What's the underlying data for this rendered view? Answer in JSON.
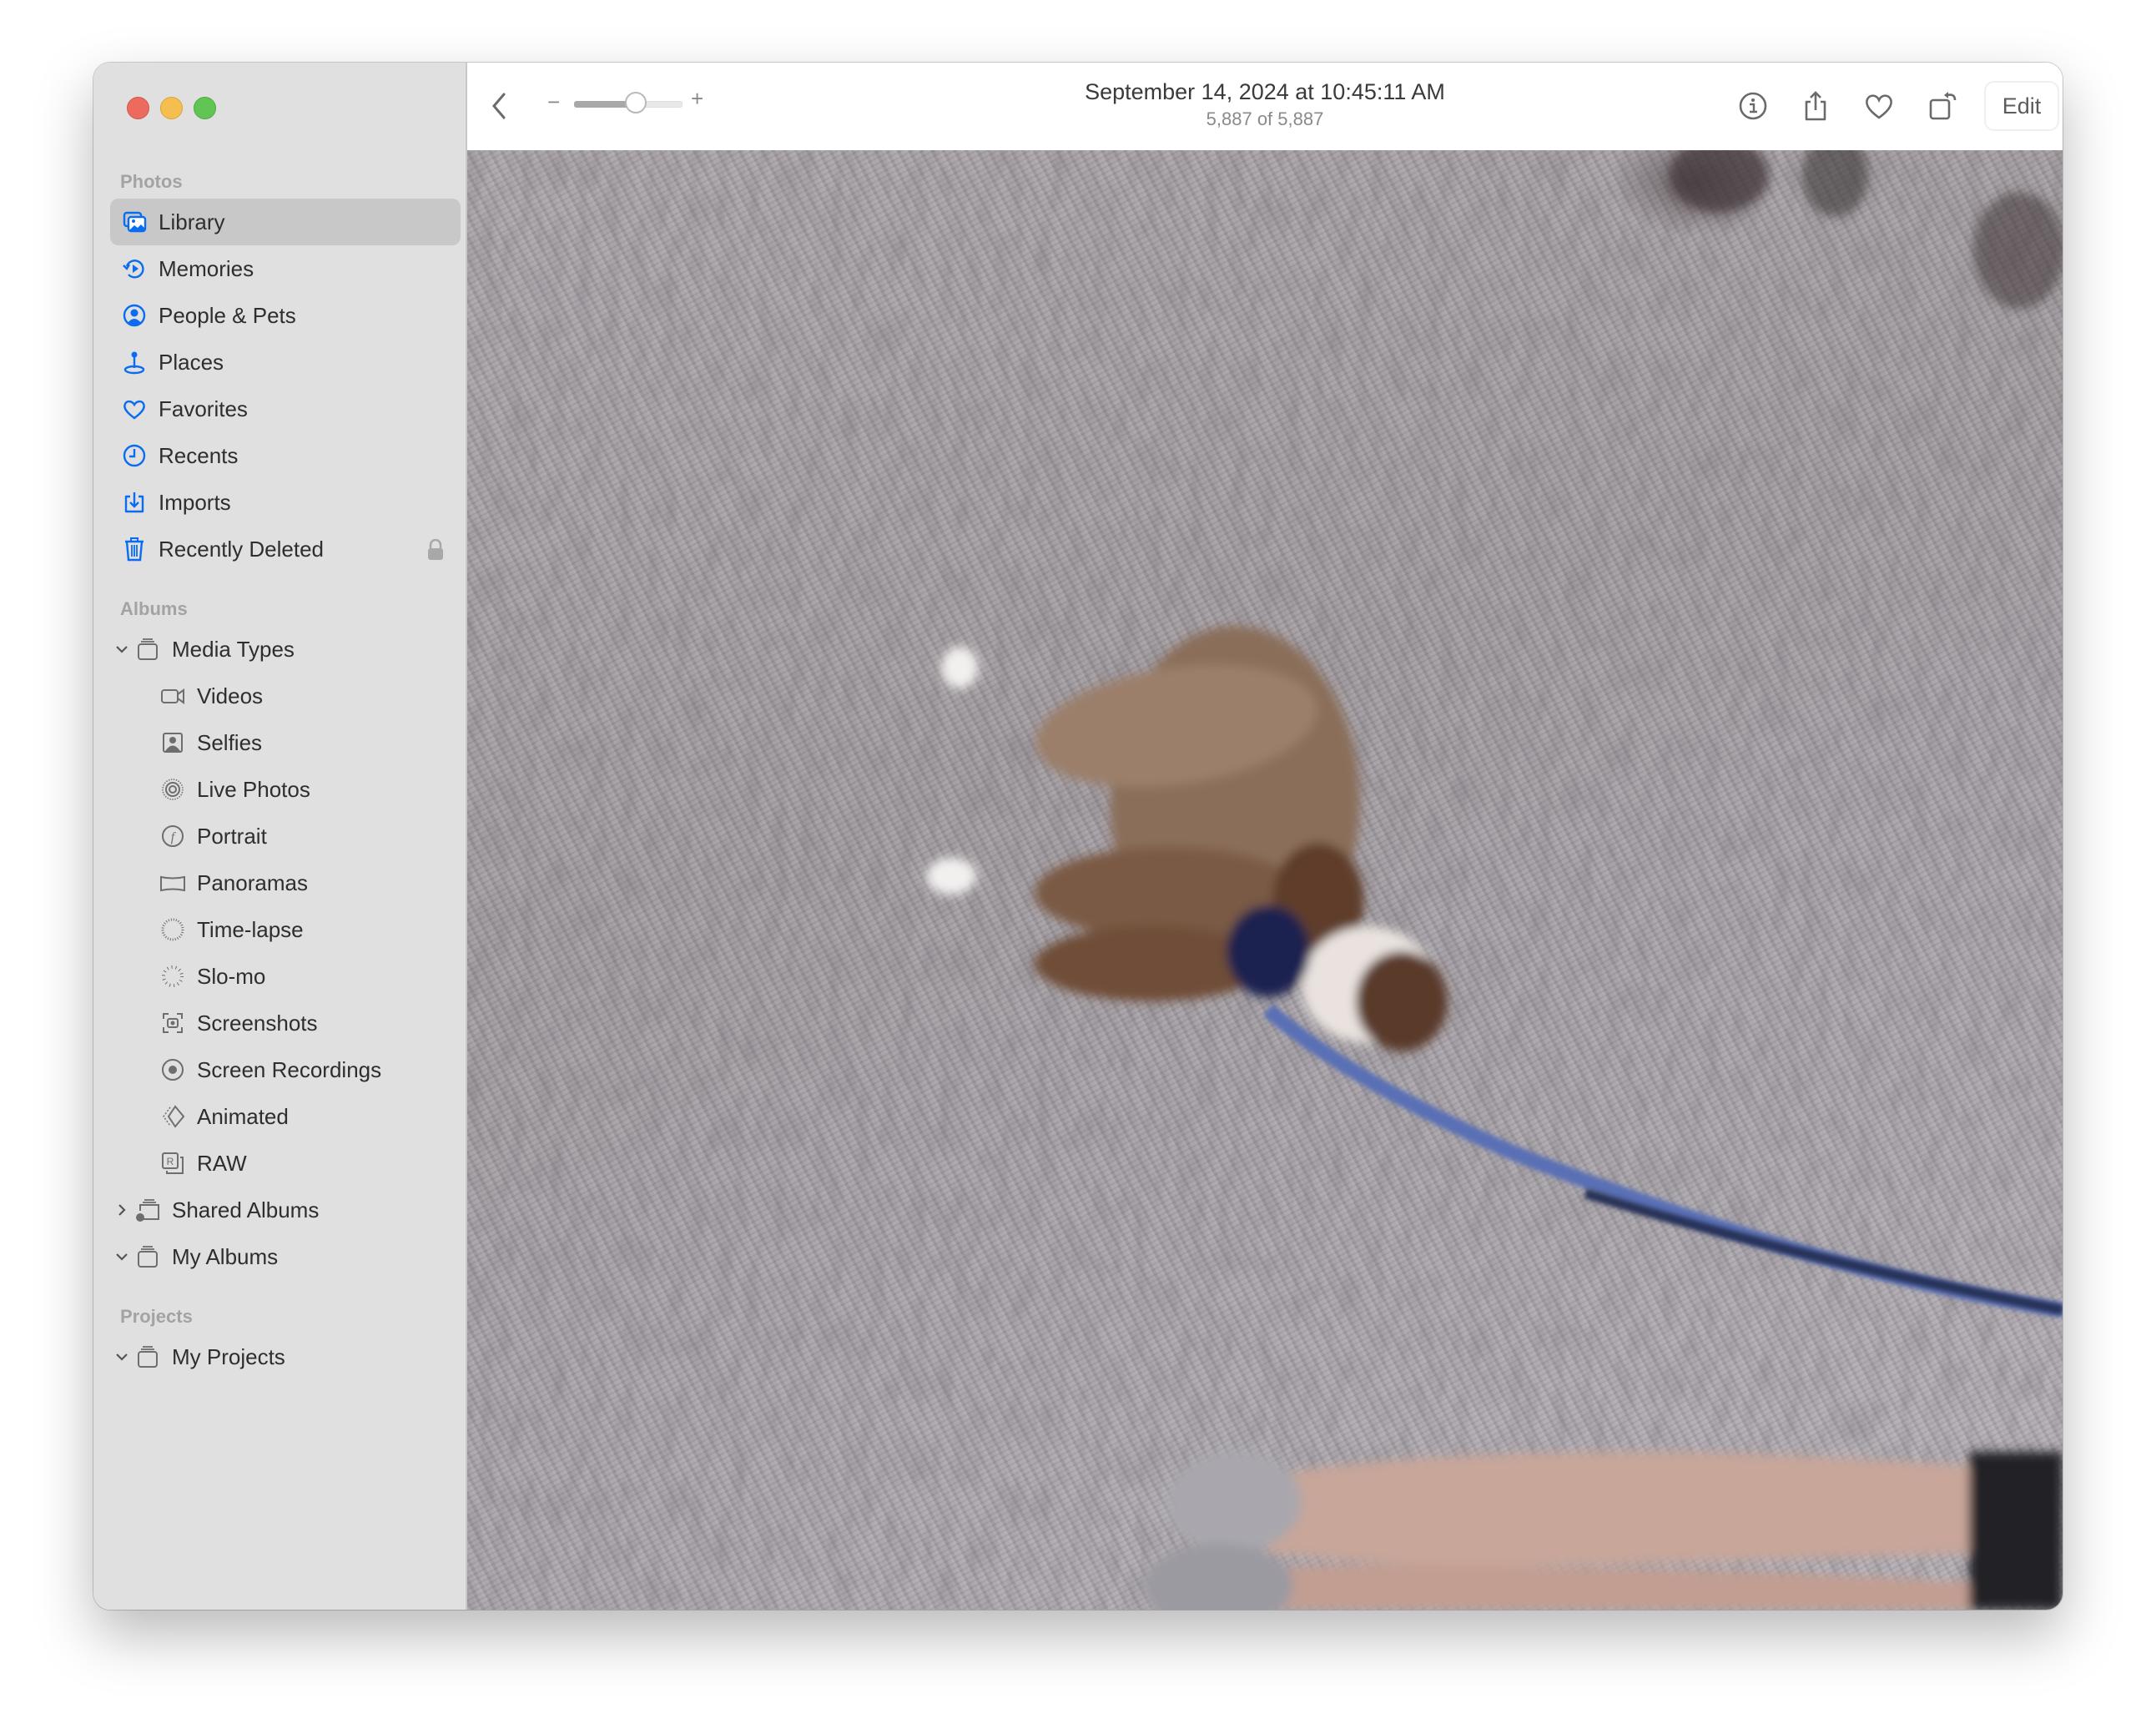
{
  "window": {
    "controls": [
      "close",
      "minimize",
      "zoom"
    ]
  },
  "sidebar": {
    "sections": {
      "photos": "Photos",
      "albums": "Albums",
      "projects": "Projects"
    },
    "photos_items": [
      {
        "label": "Library",
        "icon": "library-icon",
        "selected": true
      },
      {
        "label": "Memories",
        "icon": "memories-icon"
      },
      {
        "label": "People & Pets",
        "icon": "people-icon"
      },
      {
        "label": "Places",
        "icon": "places-pin-icon"
      },
      {
        "label": "Favorites",
        "icon": "heart-icon"
      },
      {
        "label": "Recents",
        "icon": "clock-icon"
      },
      {
        "label": "Imports",
        "icon": "import-icon"
      },
      {
        "label": "Recently Deleted",
        "icon": "trash-icon",
        "locked": true
      }
    ],
    "albums_items": [
      {
        "label": "Media Types",
        "icon": "album-stack-icon",
        "expanded": true
      },
      {
        "label": "Videos",
        "icon": "video-camera-icon"
      },
      {
        "label": "Selfies",
        "icon": "selfie-icon"
      },
      {
        "label": "Live Photos",
        "icon": "live-photo-icon"
      },
      {
        "label": "Portrait",
        "icon": "portrait-f-icon"
      },
      {
        "label": "Panoramas",
        "icon": "panorama-icon"
      },
      {
        "label": "Time-lapse",
        "icon": "timelapse-icon"
      },
      {
        "label": "Slo-mo",
        "icon": "slomo-icon"
      },
      {
        "label": "Screenshots",
        "icon": "screenshot-icon"
      },
      {
        "label": "Screen Recordings",
        "icon": "screen-recording-icon"
      },
      {
        "label": "Animated",
        "icon": "animated-icon"
      },
      {
        "label": "RAW",
        "icon": "raw-icon"
      },
      {
        "label": "Shared Albums",
        "icon": "shared-album-icon",
        "expanded": false
      },
      {
        "label": "My Albums",
        "icon": "album-stack-icon",
        "expanded": true
      }
    ],
    "projects_items": [
      {
        "label": "My Projects",
        "icon": "album-stack-icon",
        "expanded": true
      }
    ]
  },
  "toolbar": {
    "back_icon": "chevron-left-icon",
    "zoom_minus": "−",
    "zoom_plus": "+",
    "zoom_level": 0.6,
    "title": "September 14, 2024 at 10:45:11 AM",
    "subtitle": "5,887 of 5,887",
    "actions": [
      {
        "name": "info",
        "icon": "info-icon"
      },
      {
        "name": "share",
        "icon": "share-icon"
      },
      {
        "name": "favorite",
        "icon": "heart-icon"
      },
      {
        "name": "rotate",
        "icon": "rotate-icon"
      },
      {
        "name": "auto-enhance",
        "icon": "magic-wand-icon"
      }
    ],
    "edit_label": "Edit"
  },
  "photo": {
    "description": "Rotated photo of a brown and white dog on a blue leash standing on a gravel path, with a person's legs and sneakers at the bottom"
  },
  "colors": {
    "accent": "#0a6cf0",
    "sidebar_bg": "#e0e0e0",
    "selected_bg": "#c8c8c8",
    "muted_icon": "#6e6e6e"
  }
}
